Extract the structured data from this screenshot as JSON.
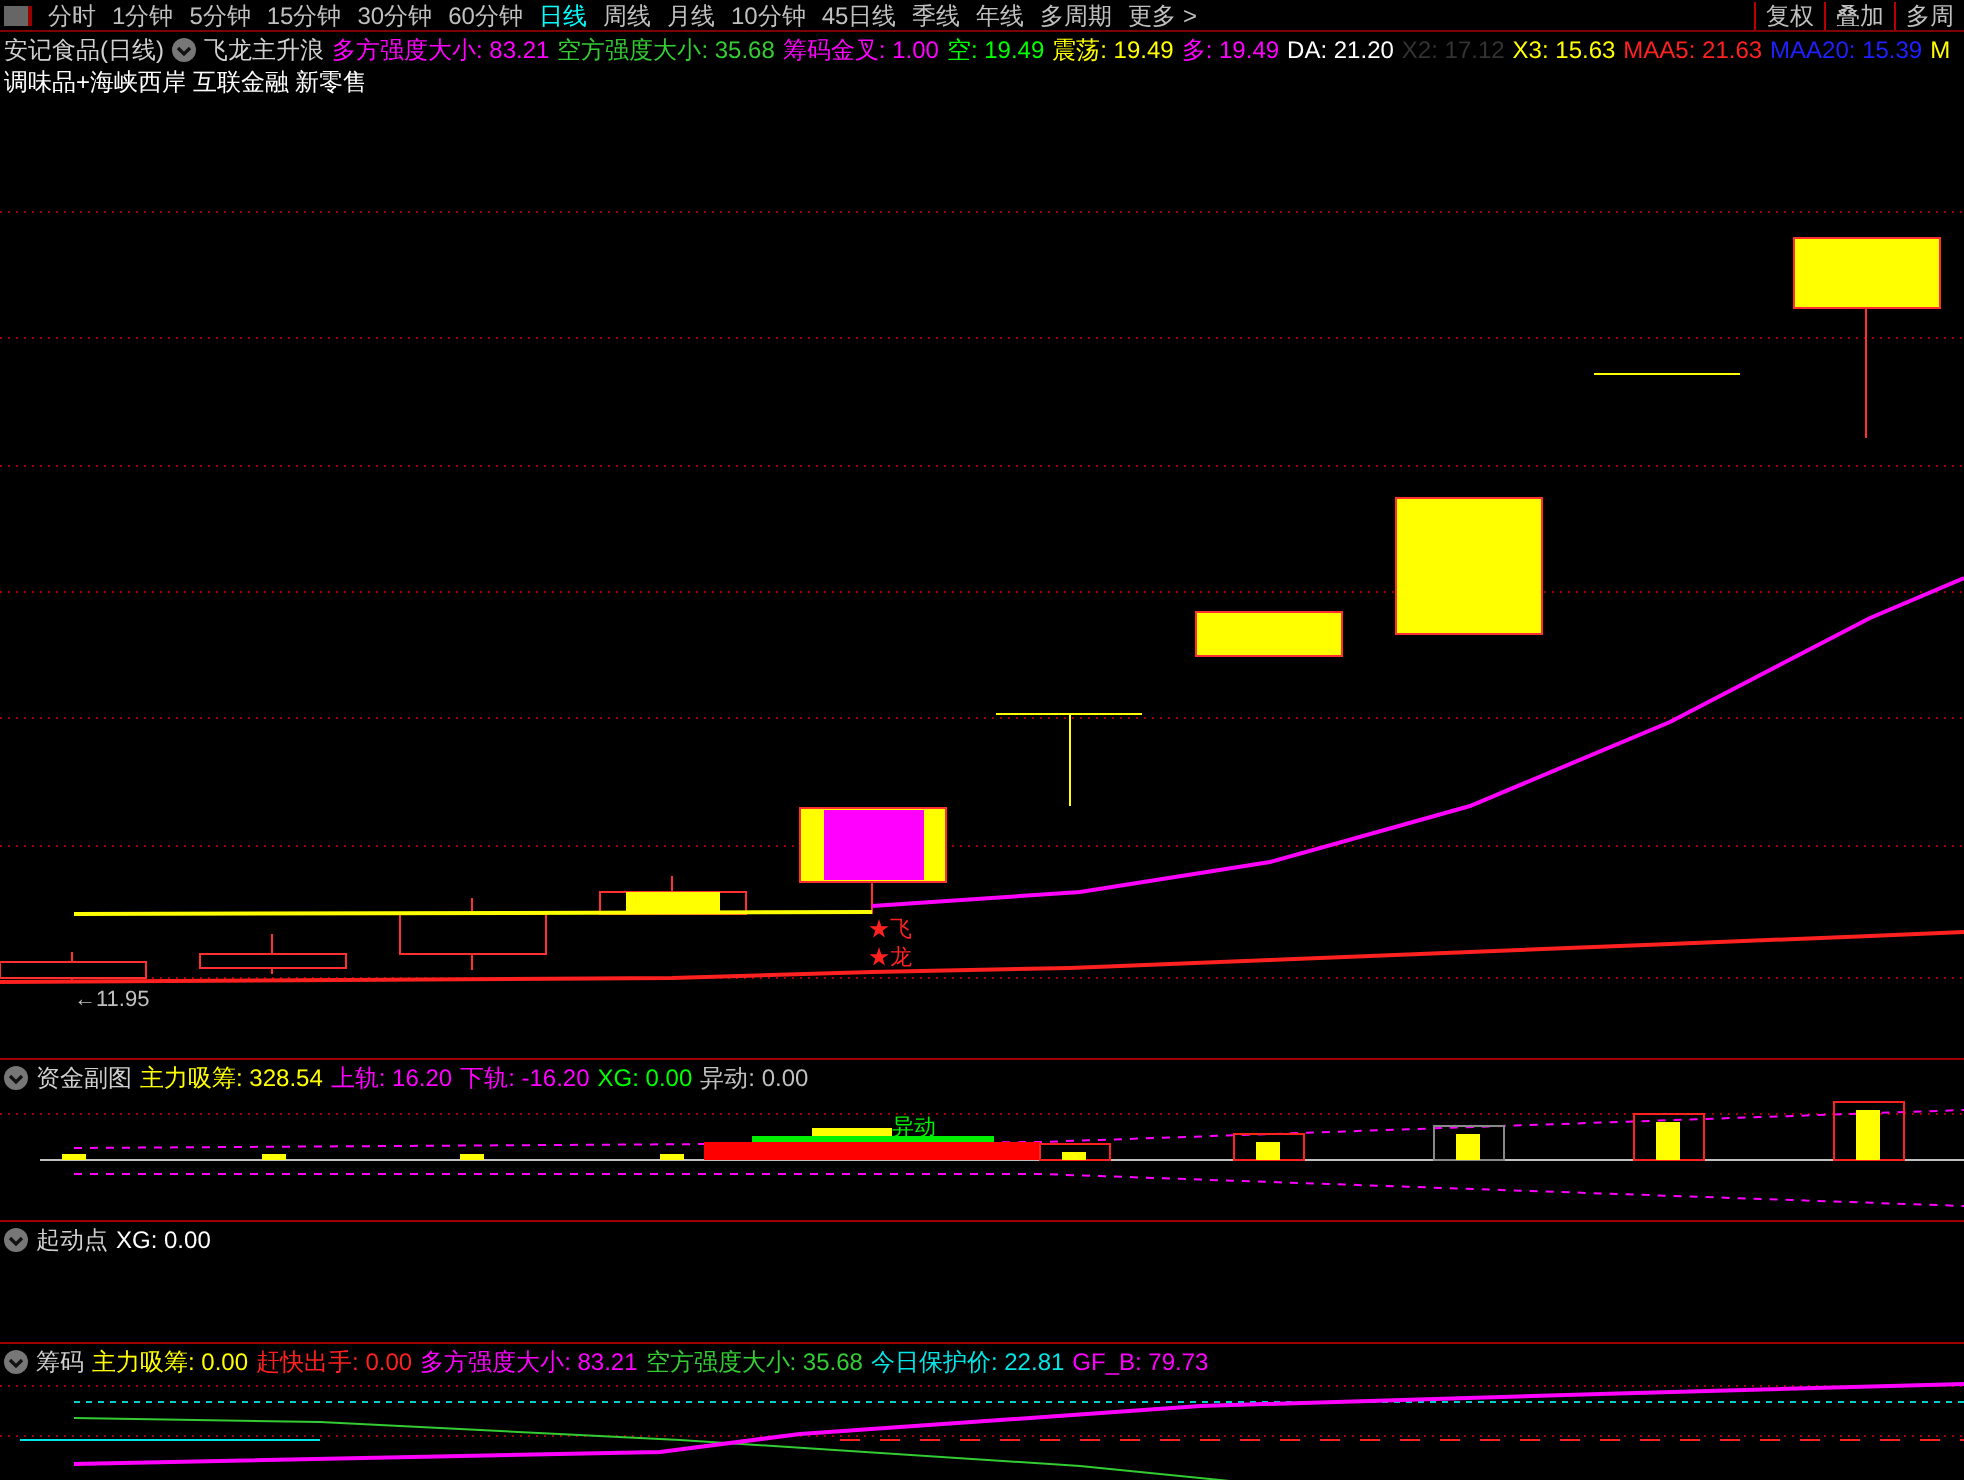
{
  "toolbar": {
    "periods": [
      {
        "label": "分时",
        "selected": false
      },
      {
        "label": "1分钟",
        "selected": false
      },
      {
        "label": "5分钟",
        "selected": false
      },
      {
        "label": "15分钟",
        "selected": false
      },
      {
        "label": "30分钟",
        "selected": false
      },
      {
        "label": "60分钟",
        "selected": false
      },
      {
        "label": "日线",
        "selected": true
      },
      {
        "label": "周线",
        "selected": false
      },
      {
        "label": "月线",
        "selected": false
      },
      {
        "label": "10分钟",
        "selected": false
      },
      {
        "label": "45日线",
        "selected": false
      },
      {
        "label": "季线",
        "selected": false
      },
      {
        "label": "年线",
        "selected": false
      },
      {
        "label": "多周期",
        "selected": false
      },
      {
        "label": "更多 >",
        "selected": false
      }
    ],
    "actions": [
      "复权",
      "叠加",
      "多周"
    ]
  },
  "main_chart": {
    "title": "安记食品(日线)",
    "indicator": "飞龙主升浪",
    "values": [
      {
        "text": "多方强度大小: 83.21",
        "color": "#ff00ff"
      },
      {
        "text": "空方强度大小: 35.68",
        "color": "#33cc33"
      },
      {
        "text": "筹码金叉: 1.00",
        "color": "#ff00ff"
      },
      {
        "text": "空: 19.49",
        "color": "#00ff00"
      },
      {
        "text": "震荡: 19.49",
        "color": "#ffff00"
      },
      {
        "text": "多: 19.49",
        "color": "#ff00ff"
      },
      {
        "text": "DA: 21.20",
        "color": "#ffffff"
      },
      {
        "text": "X2: 17.12",
        "color": "#333333"
      },
      {
        "text": "X3: 15.63",
        "color": "#ffff00"
      },
      {
        "text": "MAA5: 21.63",
        "color": "#ff2020"
      },
      {
        "text": "MAA20: 15.39",
        "color": "#2020ff"
      },
      {
        "text": "M",
        "color": "#ffff00"
      }
    ],
    "tags": "调味品+海峡西岸 互联金融 新零售",
    "price_label": "←11.95",
    "signal_top": "★飞",
    "signal_bottom": "★龙"
  },
  "panels": [
    {
      "kind": "fund",
      "title": "资金副图",
      "values": [
        {
          "text": "主力吸筹: 328.54",
          "color": "#ffff00"
        },
        {
          "text": "上轨: 16.20",
          "color": "#ff00ff"
        },
        {
          "text": "下轨: -16.20",
          "color": "#ff00ff"
        },
        {
          "text": "XG: 0.00",
          "color": "#00ff00"
        },
        {
          "text": "异动: 0.00",
          "color": "#c0c0c0"
        }
      ],
      "marker": "异动"
    },
    {
      "kind": "start",
      "title": "起动点",
      "values": [
        {
          "text": "XG: 0.00",
          "color": "#ffffff"
        }
      ]
    },
    {
      "kind": "chips",
      "title": "筹码",
      "values": [
        {
          "text": "主力吸筹: 0.00",
          "color": "#ffff00"
        },
        {
          "text": "赶快出手: 0.00",
          "color": "#ff2020"
        },
        {
          "text": "多方强度大小: 83.21",
          "color": "#ff00ff"
        },
        {
          "text": "空方强度大小: 35.68",
          "color": "#33cc33"
        },
        {
          "text": "今日保护价: 22.81",
          "color": "#00e5e5"
        },
        {
          "text": "GF_B: 79.73",
          "color": "#ff00ff"
        }
      ]
    }
  ]
}
